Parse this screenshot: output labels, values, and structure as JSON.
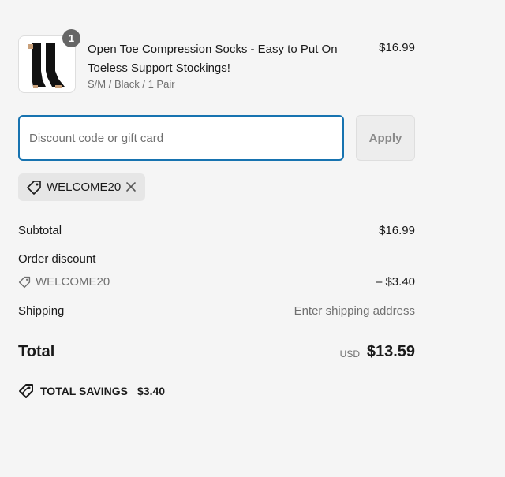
{
  "product": {
    "image_icon": "socks-image",
    "quantity": "1",
    "title": "Open Toe Compression Socks - Easy to Put On Toeless Support Stockings!",
    "variant": "S/M / Black / 1 Pair",
    "price": "$16.99"
  },
  "discount": {
    "placeholder": "Discount code or gift card",
    "value": "",
    "apply_label": "Apply",
    "applied_code": "WELCOME20",
    "remove_icon": "close-icon",
    "tag_icon": "tag-icon"
  },
  "summary": {
    "subtotal_label": "Subtotal",
    "subtotal_value": "$16.99",
    "order_discount_label": "Order discount",
    "discount_code": "WELCOME20",
    "discount_value": "– $3.40",
    "shipping_label": "Shipping",
    "shipping_value": "Enter shipping address",
    "total_label": "Total",
    "currency": "USD",
    "total_value": "$13.59",
    "savings_label": "TOTAL SAVINGS",
    "savings_value": "$3.40"
  },
  "colors": {
    "accent": "#1773b0",
    "text": "#1a1a1a",
    "muted": "#707070",
    "background": "#f5f5f5"
  }
}
